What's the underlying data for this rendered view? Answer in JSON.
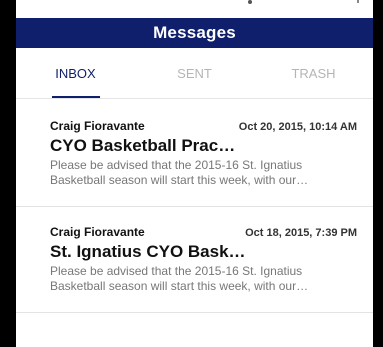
{
  "header": {
    "title": "Messages"
  },
  "tabs": [
    {
      "label": "INBOX"
    },
    {
      "label": "SENT"
    },
    {
      "label": "TRASH"
    }
  ],
  "messages": [
    {
      "sender": "Craig Fioravante",
      "date": "Oct 20, 2015, 10:14 AM",
      "subject": "CYO Basketball Prac…",
      "preview": "Please be advised that the 2015-16 St. Ignatius Basketball season will start this week, with our…"
    },
    {
      "sender": "Craig Fioravante",
      "date": "Oct 18, 2015, 7:39 PM",
      "subject": "St. Ignatius CYO Bask…",
      "preview": "Please be advised that the 2015-16 St. Ignatius Basketball season will start this week, with our…"
    }
  ],
  "colors": {
    "header_bg": "#0f1f6b",
    "tab_active": "#0f1f6b",
    "tab_inactive": "#b5b5b5"
  }
}
